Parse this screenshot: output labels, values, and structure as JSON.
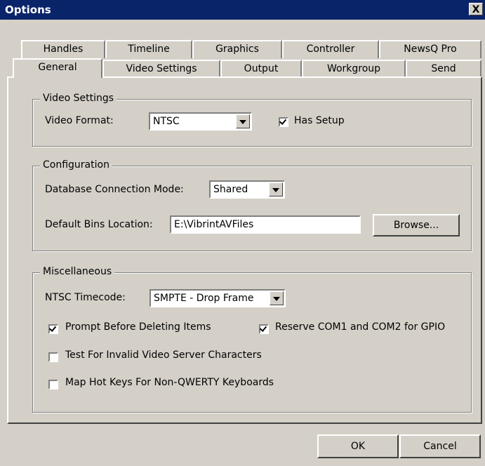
{
  "window": {
    "title": "Options",
    "close_glyph": "X"
  },
  "tabs_back": [
    {
      "label": "Handles"
    },
    {
      "label": "Timeline"
    },
    {
      "label": "Graphics"
    },
    {
      "label": "Controller"
    },
    {
      "label": "NewsQ Pro"
    }
  ],
  "tabs_front": [
    {
      "label": "General"
    },
    {
      "label": "Video Settings"
    },
    {
      "label": "Output"
    },
    {
      "label": "Workgroup"
    },
    {
      "label": "Send"
    }
  ],
  "video_settings": {
    "legend": "Video Settings",
    "format_label": "Video Format:",
    "format_value": "NTSC",
    "has_setup_label": "Has Setup",
    "has_setup_checked": true
  },
  "configuration": {
    "legend": "Configuration",
    "db_mode_label": "Database Connection Mode:",
    "db_mode_value": "Shared",
    "bins_label": "Default Bins Location:",
    "bins_value": "E:\\VibrintAVFiles",
    "browse_label": "Browse..."
  },
  "misc": {
    "legend": "Miscellaneous",
    "timecode_label": "NTSC Timecode:",
    "timecode_value": "SMPTE - Drop Frame",
    "prompt_label": "Prompt Before Deleting Items",
    "prompt_checked": true,
    "reserve_label": "Reserve COM1 and COM2 for GPIO",
    "reserve_checked": true,
    "test_label": "Test For Invalid Video Server Characters",
    "test_checked": false,
    "hotkeys_label": "Map Hot Keys For Non-QWERTY Keyboards",
    "hotkeys_checked": false
  },
  "footer": {
    "ok_label": "OK",
    "cancel_label": "Cancel"
  }
}
